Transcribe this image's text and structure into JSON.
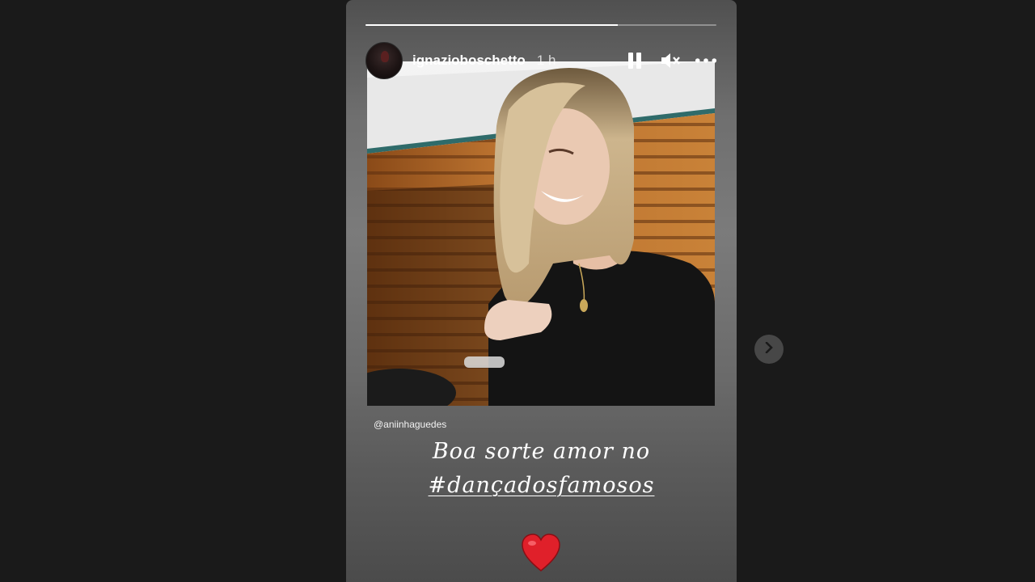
{
  "story": {
    "username": "ignazioboschetto",
    "time": "1 h",
    "progress": 0.72,
    "icons": {
      "pause": "pause-icon",
      "mute": "speaker-muted-icon",
      "more": "more-options-icon",
      "next": "chevron-right-icon"
    },
    "mention": "@aniinhaguedes",
    "caption_line1": "Boa sorte amor no",
    "caption_line2": "#dançadosfamosos",
    "sticker": "red-heart",
    "colors": {
      "background": "#1a1a1a",
      "heart": "#e0202a",
      "next_button": "#474747"
    }
  }
}
